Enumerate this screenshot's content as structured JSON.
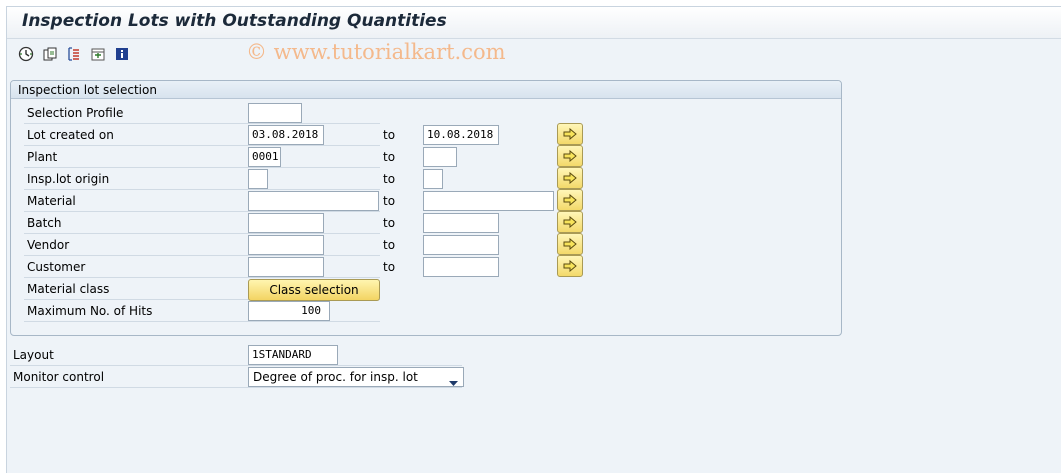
{
  "header": {
    "title": "Inspection Lots with Outstanding Quantities"
  },
  "watermark": "© www.tutorialkart.com",
  "toolbar": {
    "icons": [
      "execute-icon",
      "get-variant-icon",
      "dynamic-selection-icon",
      "selection-options-icon",
      "information-icon"
    ]
  },
  "selection_group": {
    "title": "Inspection lot selection",
    "to_label": "to",
    "rows": {
      "selection_profile": {
        "label": "Selection Profile",
        "from": ""
      },
      "lot_created_on": {
        "label": "Lot created on",
        "from": "03.08.2018",
        "to": "10.08.2018"
      },
      "plant": {
        "label": "Plant",
        "from": "0001",
        "to": ""
      },
      "insp_lot_origin": {
        "label": "Insp.lot origin",
        "from": "",
        "to": ""
      },
      "material": {
        "label": "Material",
        "from": "",
        "to": ""
      },
      "batch": {
        "label": "Batch",
        "from": "",
        "to": ""
      },
      "vendor": {
        "label": "Vendor",
        "from": "",
        "to": ""
      },
      "customer": {
        "label": "Customer",
        "from": "",
        "to": ""
      },
      "material_class": {
        "label": "Material class",
        "button": "Class selection"
      },
      "max_hits": {
        "label": "Maximum No. of Hits",
        "value": "100"
      }
    }
  },
  "layout": {
    "label": "Layout",
    "value": "1STANDARD"
  },
  "monitor_control": {
    "label": "Monitor control",
    "value": "Degree of proc. for insp. lot"
  },
  "colors": {
    "accent_yellow": "#f3d96a",
    "arrow_green": "#2f7a2a",
    "title_text": "#1c2a3a"
  }
}
